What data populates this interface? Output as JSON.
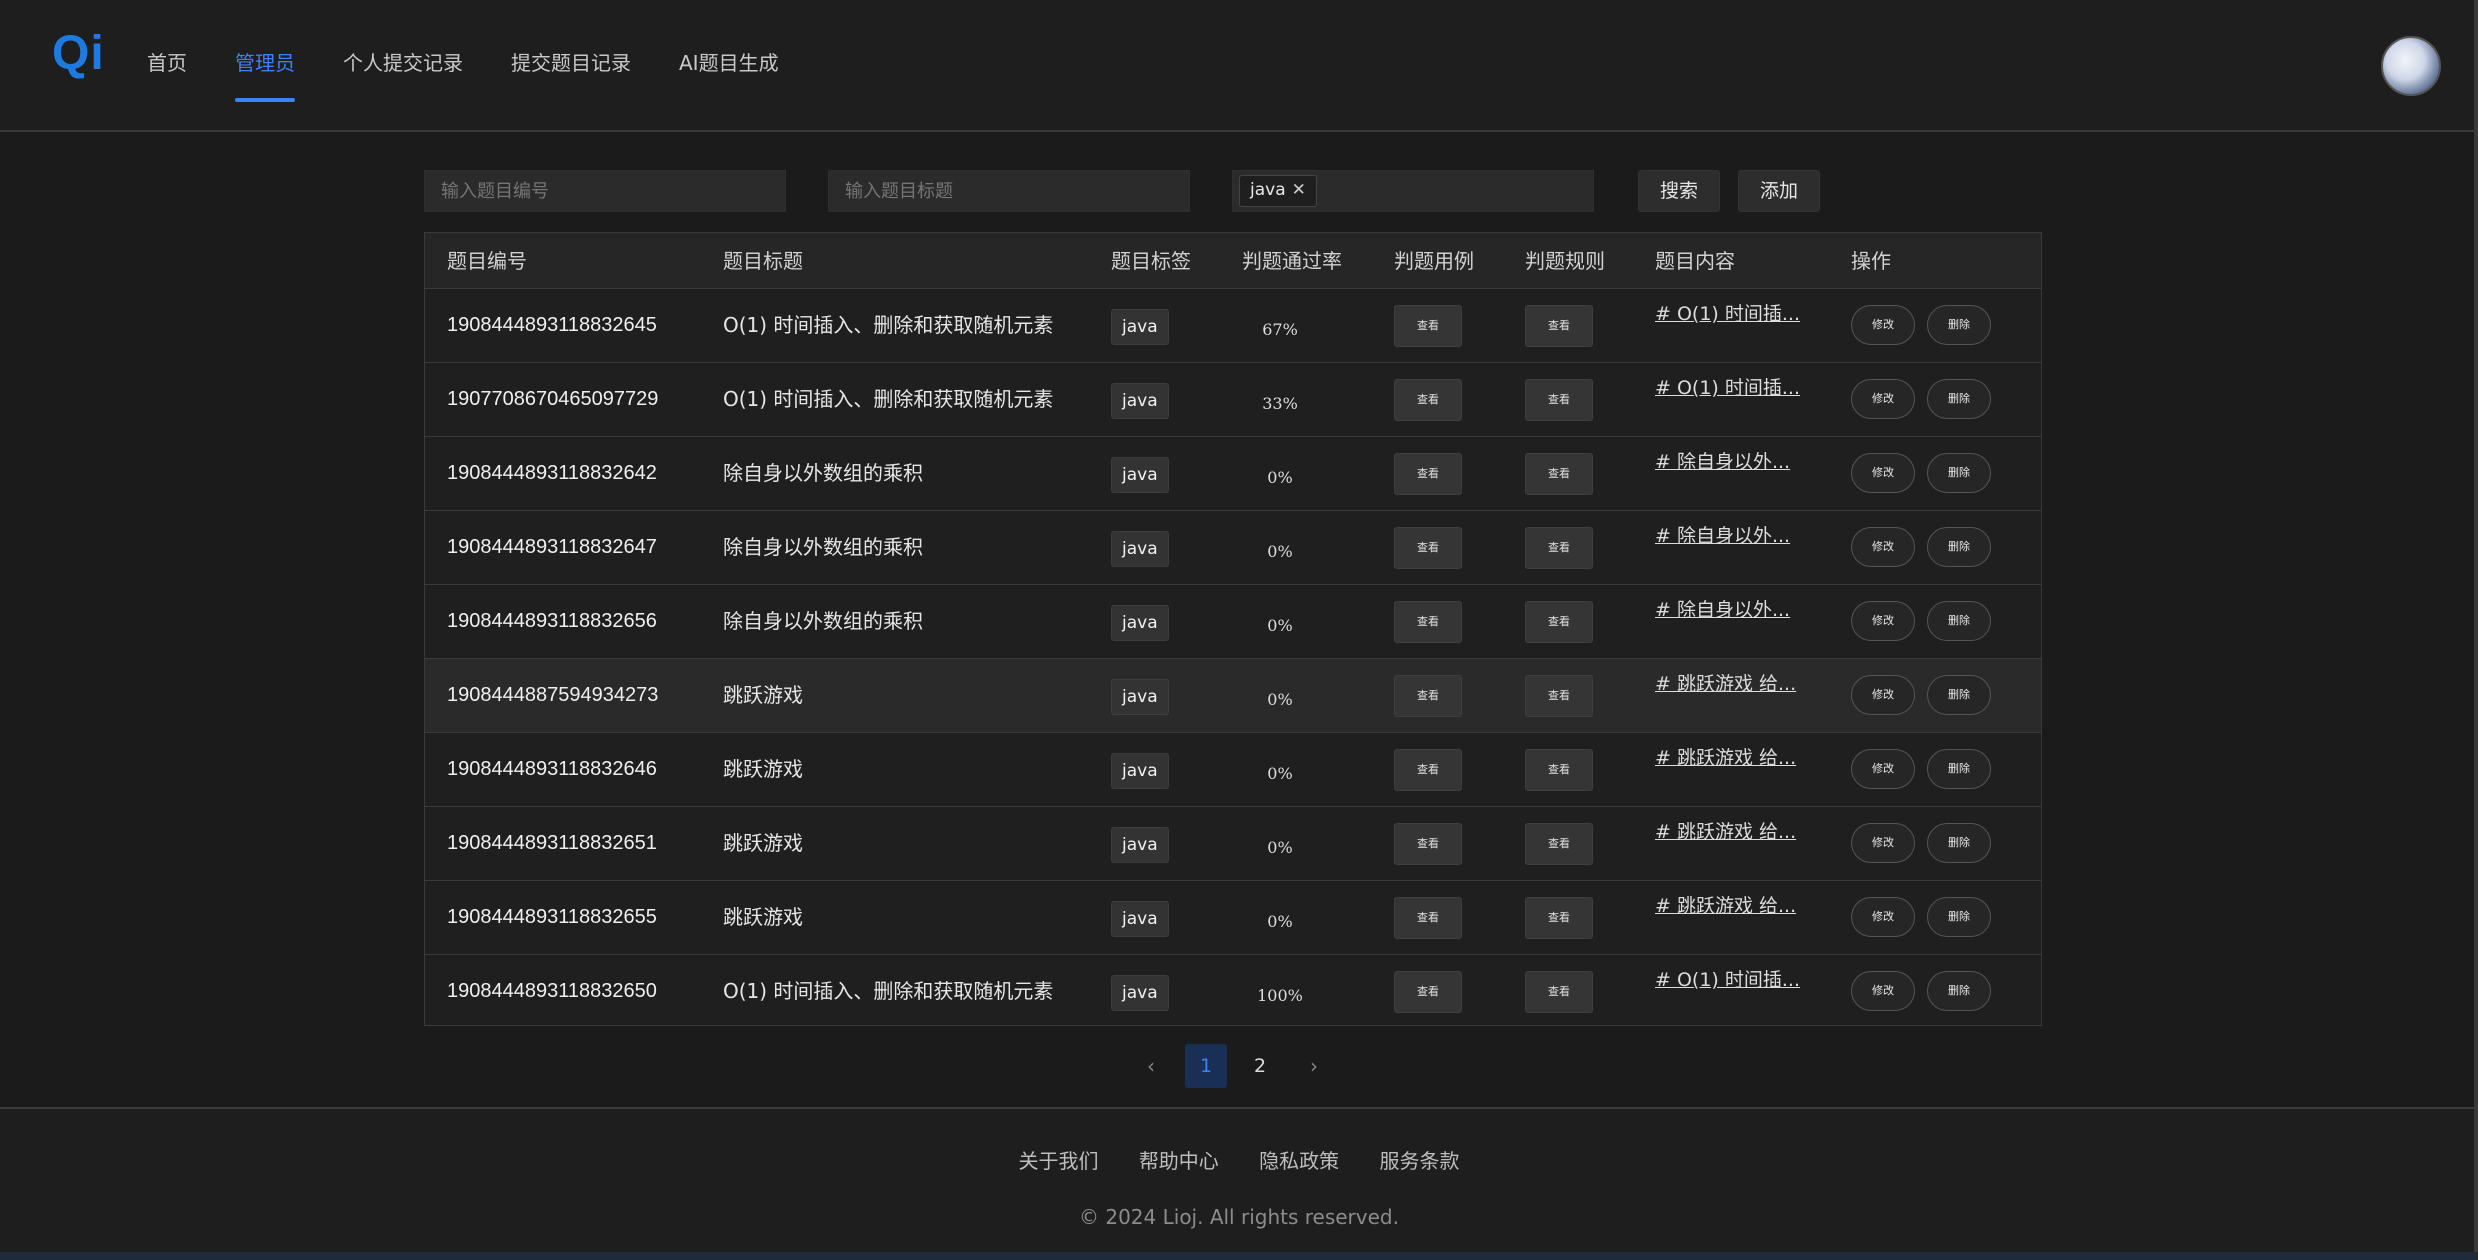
{
  "app": {
    "logo": "Qi"
  },
  "nav": [
    {
      "label": "首页",
      "active": false
    },
    {
      "label": "管理员",
      "active": true
    },
    {
      "label": "个人提交记录",
      "active": false
    },
    {
      "label": "提交题目记录",
      "active": false
    },
    {
      "label": "AI题目生成",
      "active": false
    }
  ],
  "filters": {
    "id_placeholder": "输入题目编号",
    "title_placeholder": "输入题目标题",
    "selected_tag": "java",
    "search_label": "搜索",
    "add_label": "添加"
  },
  "table": {
    "headers": [
      "题目编号",
      "题目标题",
      "题目标签",
      "判题通过率",
      "判题用例",
      "判题规则",
      "题目内容",
      "操作"
    ],
    "view_label": "查看",
    "edit_label": "修改",
    "delete_label": "删除",
    "rows": [
      {
        "id": "1908444893118832645",
        "title": "O(1) 时间插入、删除和获取随机元素",
        "tag": "java",
        "rate": "67%",
        "content": "# O(1) 时间插...",
        "highlight": false
      },
      {
        "id": "1907708670465097729",
        "title": "O(1) 时间插入、删除和获取随机元素",
        "tag": "java",
        "rate": "33%",
        "content": "# O(1) 时间插...",
        "highlight": false
      },
      {
        "id": "1908444893118832642",
        "title": "除自身以外数组的乘积",
        "tag": "java",
        "rate": "0%",
        "content": "# 除自身以外...",
        "highlight": false
      },
      {
        "id": "1908444893118832647",
        "title": "除自身以外数组的乘积",
        "tag": "java",
        "rate": "0%",
        "content": "# 除自身以外...",
        "highlight": false
      },
      {
        "id": "1908444893118832656",
        "title": "除自身以外数组的乘积",
        "tag": "java",
        "rate": "0%",
        "content": "# 除自身以外...",
        "highlight": false
      },
      {
        "id": "1908444887594934273",
        "title": "跳跃游戏",
        "tag": "java",
        "rate": "0%",
        "content": "# 跳跃游戏 给...",
        "highlight": true
      },
      {
        "id": "1908444893118832646",
        "title": "跳跃游戏",
        "tag": "java",
        "rate": "0%",
        "content": "# 跳跃游戏 给...",
        "highlight": false
      },
      {
        "id": "1908444893118832651",
        "title": "跳跃游戏",
        "tag": "java",
        "rate": "0%",
        "content": "# 跳跃游戏 给...",
        "highlight": false
      },
      {
        "id": "1908444893118832655",
        "title": "跳跃游戏",
        "tag": "java",
        "rate": "0%",
        "content": "# 跳跃游戏 给...",
        "highlight": false
      },
      {
        "id": "1908444893118832650",
        "title": "O(1) 时间插入、删除和获取随机元素",
        "tag": "java",
        "rate": "100%",
        "content": "# O(1) 时间插...",
        "highlight": false
      }
    ]
  },
  "pagination": {
    "prev": "‹",
    "pages": [
      "1",
      "2"
    ],
    "current": "1",
    "next": "›"
  },
  "footer": {
    "links": [
      "关于我们",
      "帮助中心",
      "隐私政策",
      "服务条款"
    ],
    "copyright": "© 2024 Lioj. All rights reserved."
  },
  "colors": {
    "accent": "#3b82f6",
    "logo": "#1f7ae0",
    "background": "#1b1b1b"
  }
}
